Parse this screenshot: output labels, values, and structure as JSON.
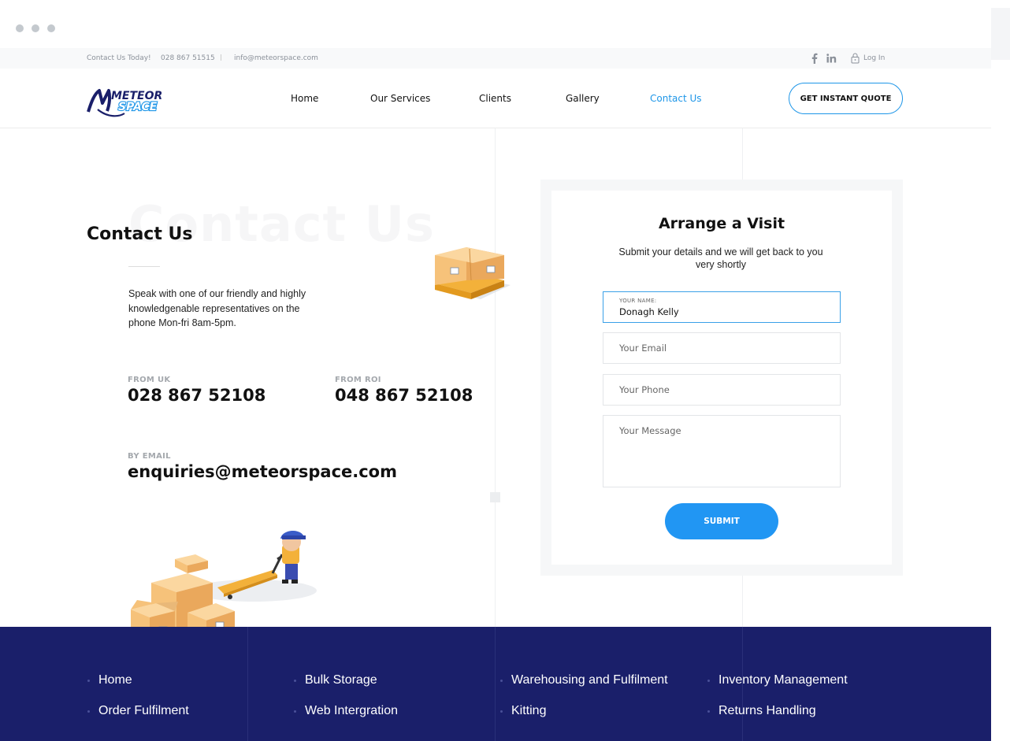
{
  "topbar": {
    "contact_today": "Contact Us Today!",
    "phone": "028 867 51515",
    "email": "info@meteorspace.com",
    "login": "Log In",
    "facebook_icon": "facebook-icon",
    "linkedin_icon": "linkedin-icon",
    "lock_icon": "lock-icon"
  },
  "brand": {
    "logo_line1": "METEOR",
    "logo_line2": "SPACE",
    "navy": "#1a1f6a",
    "accent": "#1e96e8"
  },
  "nav": {
    "items": [
      "Home",
      "Our Services",
      "Clients",
      "Gallery",
      "Contact Us"
    ],
    "active": "Contact Us",
    "cta": "GET INSTANT QUOTE"
  },
  "contact": {
    "ghost_title": "Contact Us",
    "title": "Contact Us",
    "intro": "Speak with one of our friendly and highly knowledgenable representatives on the phone Mon-fri 8am-5pm.",
    "uk_label": "FROM UK",
    "uk_phone": "028 867 52108",
    "roi_label": "FROM ROI",
    "roi_phone": "048 867 52108",
    "email_label": "BY EMAIL",
    "email": "enquiries@meteorspace.com"
  },
  "form": {
    "title": "Arrange a Visit",
    "subtitle": "Submit your details and we will get back to you very shortly",
    "name_label": "YOUR NAME:",
    "name_value": "Donagh Kelly",
    "email_placeholder": "Your Email",
    "phone_placeholder": "Your Phone",
    "message_placeholder": "Your Message",
    "submit": "SUBMIT"
  },
  "footer": {
    "links": [
      "Home",
      "Bulk Storage",
      "Warehousing and Fulfilment",
      "Inventory Management",
      "Order Fulfilment",
      "Web Intergration",
      "Kitting",
      "Returns Handling"
    ]
  }
}
